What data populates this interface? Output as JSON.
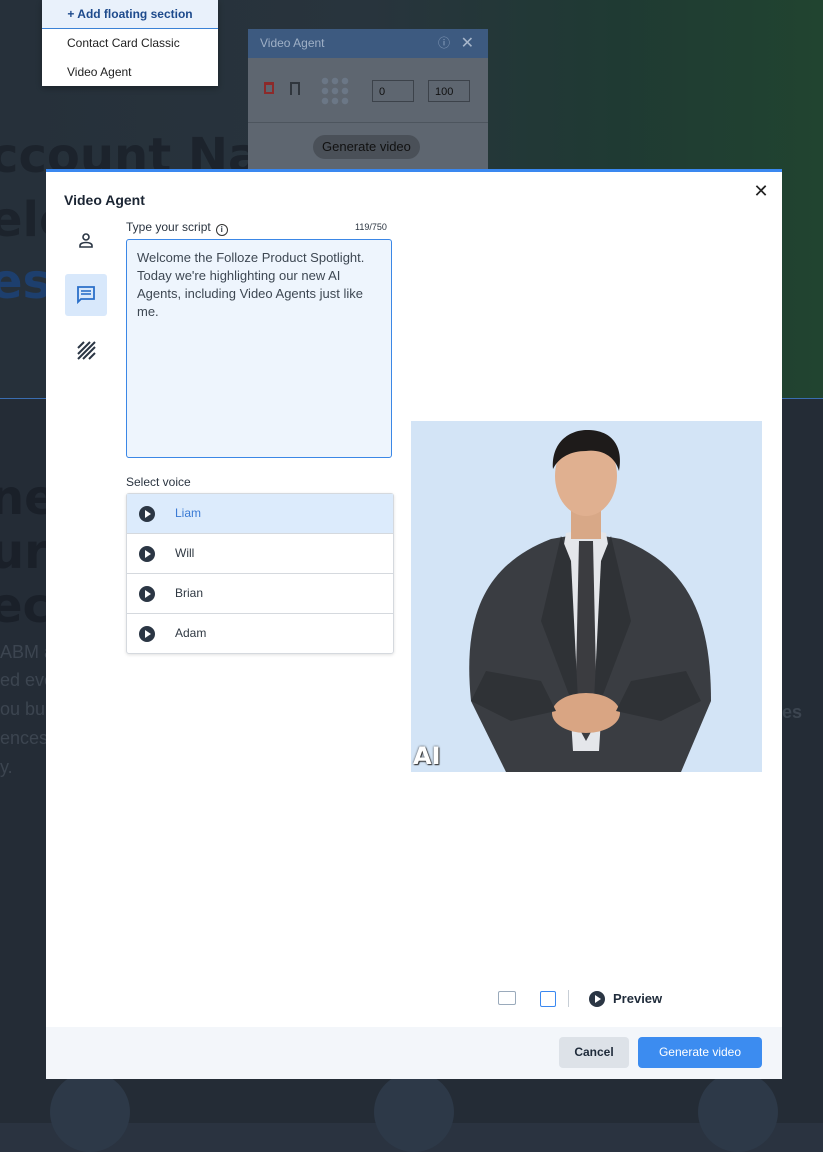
{
  "background": {
    "headings": [
      "ccount Na",
      "elc",
      "esc",
      "nes",
      "ur A",
      "ecu"
    ],
    "texts": [
      "ABM a",
      "ed eve",
      "ou bu",
      "ences",
      "y."
    ],
    "right_fragment": "es"
  },
  "floating_menu": {
    "add_label": "+ Add floating section",
    "items": [
      "Contact Card Classic",
      "Video Agent"
    ]
  },
  "mini_panel": {
    "title": "Video Agent",
    "field_a": "0",
    "field_b": "100",
    "generate_label": "Generate video"
  },
  "modal": {
    "title": "Video Agent",
    "sidebar_tabs": [
      "avatar",
      "script",
      "background"
    ],
    "script": {
      "label": "Type your script",
      "counter": "119/750",
      "text": "Welcome the Folloze Product Spotlight. Today we're highlighting our new AI Agents, including Video Agents just like me."
    },
    "voice": {
      "label": "Select voice",
      "options": [
        "Liam",
        "Will",
        "Brian",
        "Adam"
      ],
      "selected": "Liam"
    },
    "avatar_badge": "AI",
    "preview_label": "Preview",
    "footer": {
      "cancel_label": "Cancel",
      "generate_label": "Generate video"
    }
  },
  "colors": {
    "accent": "#3c8cf0",
    "selected_bg": "#dcebfc"
  }
}
